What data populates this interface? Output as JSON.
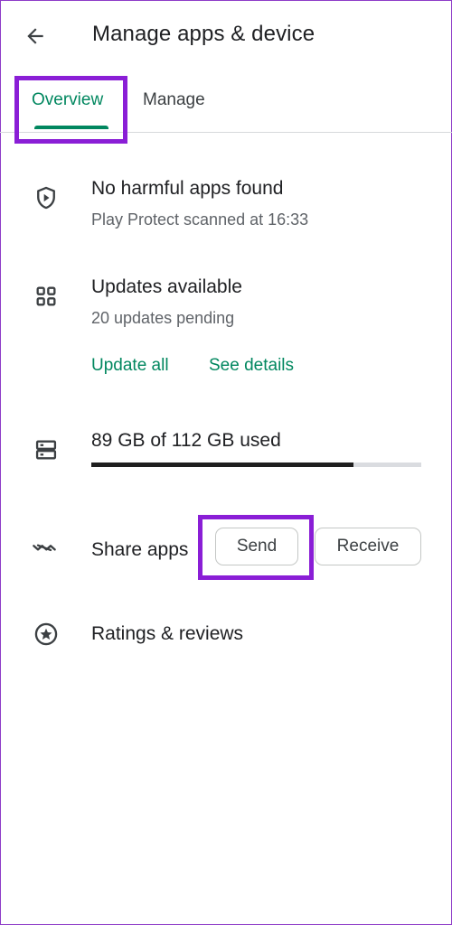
{
  "header": {
    "title": "Manage apps & device",
    "back_icon": "arrow-back-icon"
  },
  "tabs": [
    {
      "label": "Overview",
      "selected": true
    },
    {
      "label": "Manage",
      "selected": false
    }
  ],
  "overview": {
    "protect": {
      "icon": "shield-play-icon",
      "title": "No harmful apps found",
      "subtitle": "Play Protect scanned at 16:33"
    },
    "updates": {
      "icon": "apps-grid-icon",
      "title": "Updates available",
      "subtitle": "20 updates pending",
      "update_all": "Update all",
      "see_details": "See details"
    },
    "storage": {
      "icon": "storage-icon",
      "title": "89 GB of 112 GB used",
      "used_gb": 89,
      "total_gb": 112
    },
    "share": {
      "icon": "share-apps-icon",
      "title": "Share apps",
      "send": "Send",
      "receive": "Receive"
    },
    "ratings": {
      "icon": "star-circle-icon",
      "title": "Ratings & reviews"
    }
  },
  "colors": {
    "accent": "#01875f",
    "highlight": "#8a1ed6",
    "text": "#202124",
    "secondary": "#5f6368"
  }
}
